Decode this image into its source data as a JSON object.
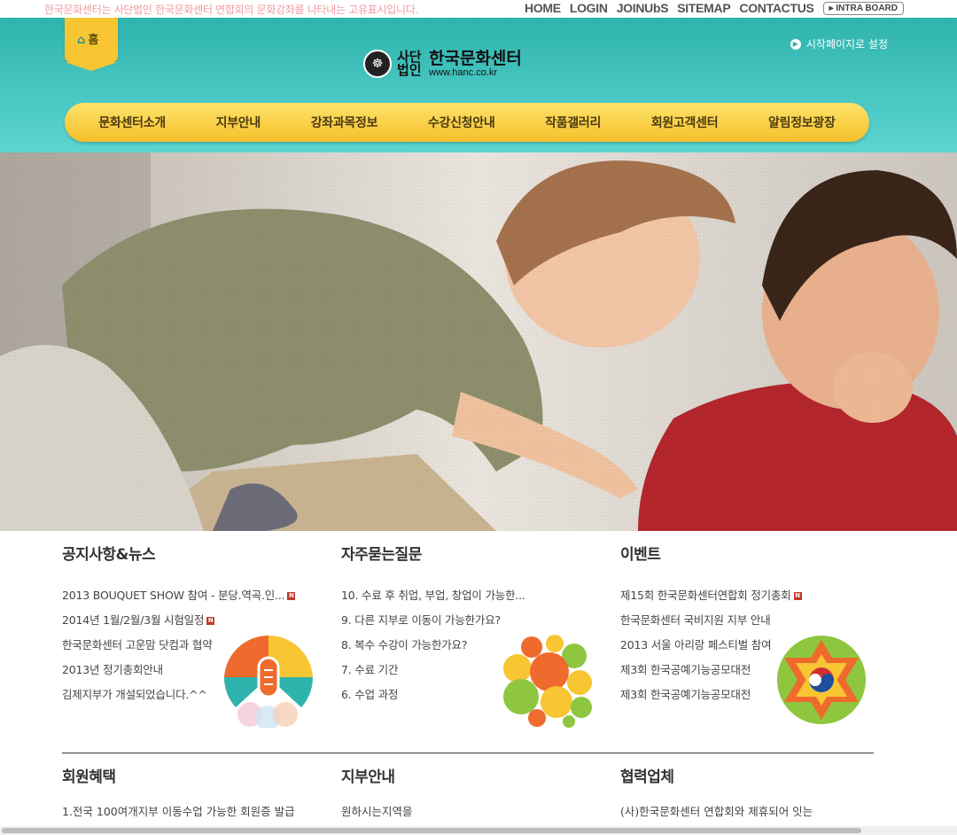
{
  "topbar": {
    "slogan": "한국문화센터는 사단법인 한국문화센터 연합회의 문화강좌를 나타내는 고유표시입니다.",
    "links": [
      "HOME",
      "LOGIN",
      "JOINUbS",
      "SITEMAP",
      "CONTACTUS"
    ],
    "intra": "INTRA BOARD"
  },
  "header": {
    "home_label": "홈",
    "start_page": "시작페이지로 설정",
    "logo_small": "사단법인",
    "logo_main": "한국문화센터",
    "logo_url": "www.hanc.co.kr"
  },
  "nav": [
    "문화센터소개",
    "지부안내",
    "강좌과목정보",
    "수강신청안내",
    "작품갤러리",
    "회원고객센터",
    "알림정보광장"
  ],
  "sections": {
    "notice": {
      "title": "공지사항&뉴스",
      "items": [
        {
          "text": "2013 BOUQUET SHOW 참여 - 분당.역곡.인...",
          "new": true
        },
        {
          "text": "2014년 1월/2월/3월 시험일정",
          "new": true
        },
        {
          "text": "한국문화센터 고운맘 닷컴과 협약",
          "new": false
        },
        {
          "text": "2013년 정기총회안내",
          "new": false
        },
        {
          "text": "김제지부가 개설되었습니다.^^",
          "new": false
        }
      ]
    },
    "faq": {
      "title": "자주묻는질문",
      "items": [
        "10. 수료 후 취업, 부업, 창업이 가능한...",
        "9. 다른 지부로 이동이 가능한가요?",
        "8. 복수 수강이 가능한가요?",
        "7. 수료 기간",
        "6. 수업 과정"
      ]
    },
    "event": {
      "title": "이벤트",
      "items": [
        {
          "text": "제15회 한국문화센터연합회 정기총회",
          "new": true
        },
        {
          "text": "한국문화센터 국비지원 지부 안내",
          "new": false
        },
        {
          "text": "2013 서울 아리랑 페스티벌 참여",
          "new": false
        },
        {
          "text": "제3회 한국공예기능공모대전",
          "new": false
        },
        {
          "text": "제3회 한국공예기능공모대전",
          "new": false
        }
      ]
    },
    "benefit": {
      "title": "회원혜택",
      "text": "1.전국 100여개지부 이동수업 가능한 회원증 발급"
    },
    "branch": {
      "title": "지부안내",
      "text": "원하시는지역을"
    },
    "partner": {
      "title": "협력업체",
      "text": "(사)한국문화센터 연합회와 제휴되어 잇는"
    },
    "new_badge": "N"
  }
}
